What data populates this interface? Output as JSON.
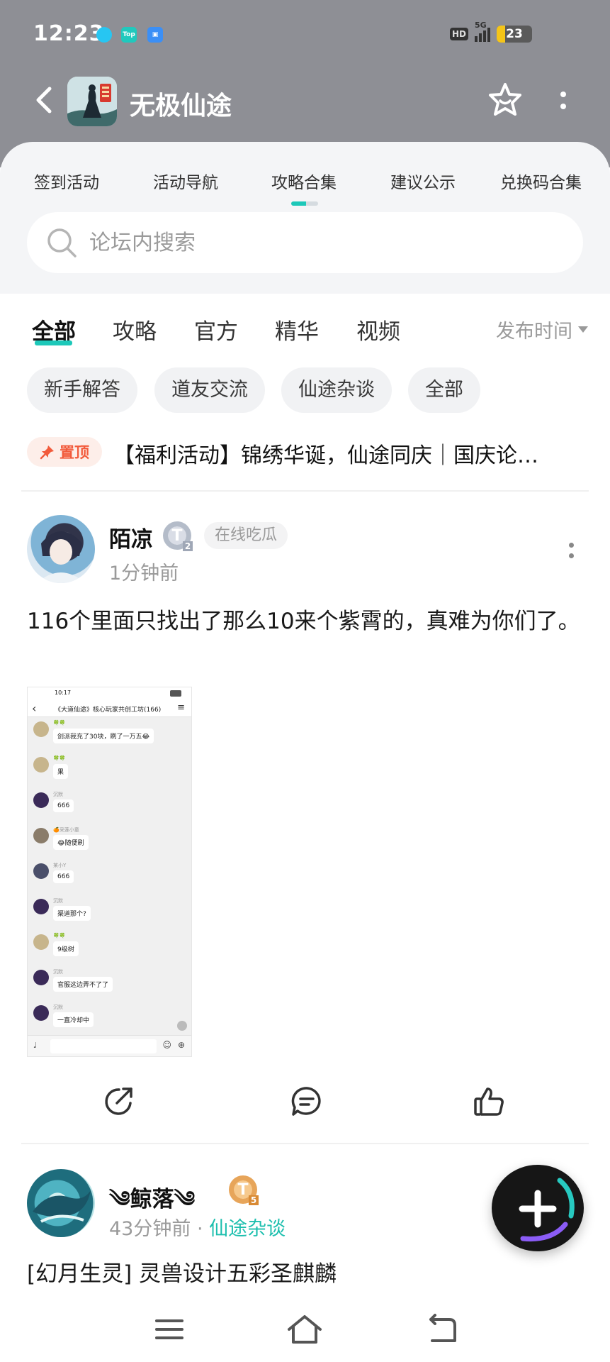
{
  "status_bar": {
    "time": "12:23",
    "indicators": [
      "HD",
      "5G"
    ],
    "battery_level": "23",
    "app_icons": [
      "bubble-app-icon",
      "top-app-icon",
      "tv-app-icon"
    ]
  },
  "header": {
    "game_title": "无极仙途",
    "icons": [
      "back-arrow-icon",
      "game-app-icon",
      "favorite-star-icon",
      "more-vertical-icon"
    ]
  },
  "nav_tabs": [
    {
      "label": "签到活动"
    },
    {
      "label": "活动导航"
    },
    {
      "label": "攻略合集",
      "active": true
    },
    {
      "label": "建议公示"
    },
    {
      "label": "兑换码合集"
    }
  ],
  "search": {
    "placeholder": "论坛内搜索"
  },
  "filter_tabs": [
    {
      "label": "全部",
      "active": true
    },
    {
      "label": "攻略"
    },
    {
      "label": "官方"
    },
    {
      "label": "精华"
    },
    {
      "label": "视频"
    }
  ],
  "sort": {
    "label": "发布时间"
  },
  "chips": [
    {
      "label": "新手解答"
    },
    {
      "label": "道友交流"
    },
    {
      "label": "仙途杂谈"
    },
    {
      "label": "全部"
    }
  ],
  "pinned": {
    "badge": "置顶",
    "title": "【福利活动】锦绣华诞，仙途同庆｜国庆论…"
  },
  "posts": [
    {
      "author": "陌凉",
      "level": "T",
      "level_sub": "2",
      "status": "在线吃瓜",
      "time": "1分钟前",
      "text": "116个里面只找出了那么10来个紫霄的，真难为你们了。",
      "screenshot": {
        "time": "10:17",
        "title": "《大道仙途》核心玩家共创工坊(166)",
        "messages": [
          {
            "name": "🍀🍀",
            "text": "剑派我充了30块，刷了一万五😂"
          },
          {
            "name": "🍀🍀",
            "text": "果"
          },
          {
            "name": "沉默",
            "text": "666"
          },
          {
            "name": "🍊采莲小童",
            "text": "😂随便刷"
          },
          {
            "name": "某小Y",
            "text": "666"
          },
          {
            "name": "沉默",
            "text": "渠道那个?"
          },
          {
            "name": "🍀🍀",
            "text": "9级树"
          },
          {
            "name": "沉默",
            "text": "官服这边弄不了了"
          },
          {
            "name": "沉默",
            "text": "一直冷却中"
          }
        ]
      }
    },
    {
      "author": "༄鲸落༄",
      "level": "T",
      "level_sub": "5",
      "time": "43分钟前",
      "separator": "·",
      "category": "仙途杂谈",
      "text": "[幻月生灵] 灵兽设计五彩圣麒麟"
    }
  ],
  "post_actions": [
    "share-icon",
    "comment-icon",
    "like-icon"
  ],
  "fab": {
    "icon": "plus-icon"
  },
  "system_nav": [
    "menu-icon",
    "home-icon",
    "back-icon"
  ],
  "colors": {
    "accent": "#1dc8b9",
    "header_bg": "#8e8f95",
    "pin": "#f25b3c"
  }
}
